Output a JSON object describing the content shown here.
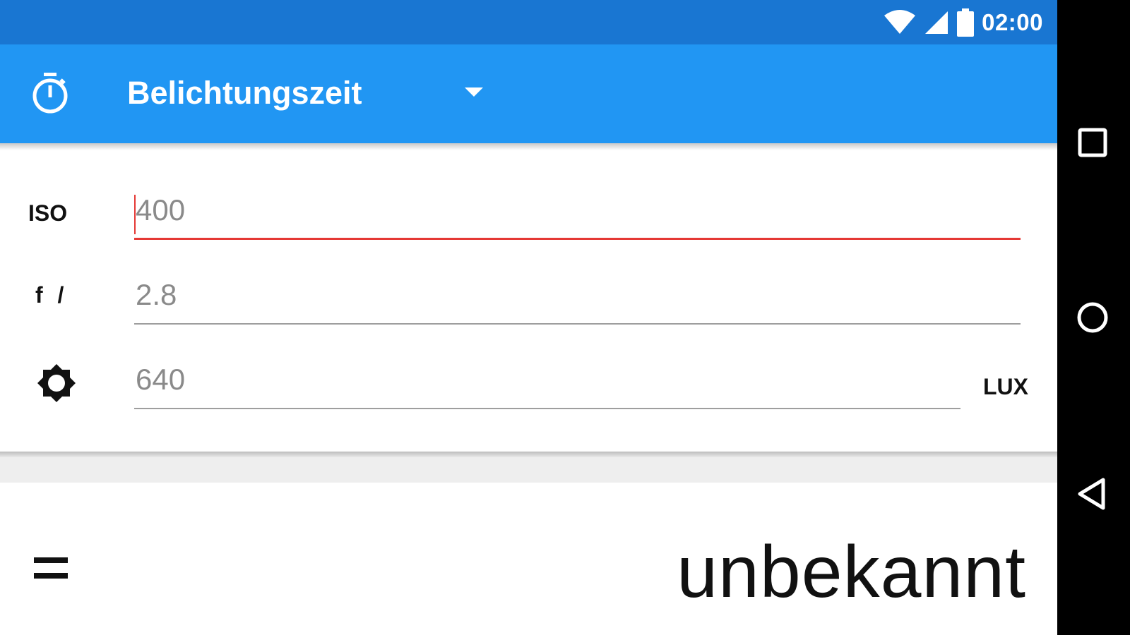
{
  "status_bar": {
    "time": "02:00"
  },
  "app_bar": {
    "mode_selector_value": "Belichtungszeit"
  },
  "form": {
    "iso": {
      "label": "ISO",
      "value": "400"
    },
    "aperture": {
      "label": "f /",
      "value": "2.8"
    },
    "brightness": {
      "value": "640",
      "unit": "LUX"
    }
  },
  "result": {
    "value": "unbekannt"
  },
  "icons": {
    "app": "timer-icon",
    "status": [
      "wifi-icon",
      "cell-signal-icon",
      "battery-icon"
    ],
    "brightness": "brightness-icon",
    "equals": "equals-icon",
    "nav": [
      "recent-apps-icon",
      "home-icon",
      "back-icon"
    ]
  },
  "colors": {
    "status_bar": "#1976d2",
    "app_bar": "#2196f3",
    "focus_accent": "#e53935"
  }
}
